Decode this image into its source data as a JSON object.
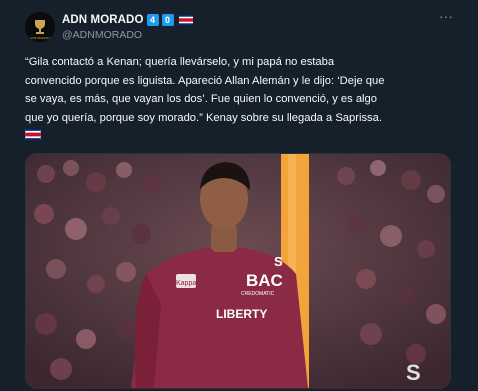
{
  "author": {
    "display_name": "ADN MORADO",
    "badges": [
      "4",
      "0"
    ],
    "handle": "@ADNMORADO",
    "flag": "costa-rica-flag-icon",
    "avatar_icon": "cup-logo-icon"
  },
  "menu": {
    "label": "···",
    "icon": "more-icon"
  },
  "tweet": {
    "lines": [
      "“Gila contactó a Kenan; quería llevárselo, y mi papá no estaba",
      "convencido porque es liguista. Apareció Allan Alemán y le dijo: ‘Deje que",
      "se vaya, es más, que vayan los dos’. Fue quien lo convenció, y es algo",
      "que yo quería, porque soy morado.” Kenay sobre su llegada a Saprissa."
    ],
    "trailing_flag": "costa-rica-flag-icon"
  },
  "media": {
    "jersey_texts": {
      "sponsor_main": "BAC",
      "sponsor_sub": "CREDOMATIC",
      "sponsor_chest": "LIBERTY",
      "crest": "S",
      "brand": "Kappa"
    },
    "corner_text": "S",
    "colors": {
      "jersey": "#8b2a44",
      "stripe": "#f2a43a",
      "crowd": "#5b3b45"
    }
  },
  "colors": {
    "background": "#15202b",
    "text": "#f7f9f9",
    "muted": "#8b98a5",
    "badge": "#1d9bf0"
  }
}
